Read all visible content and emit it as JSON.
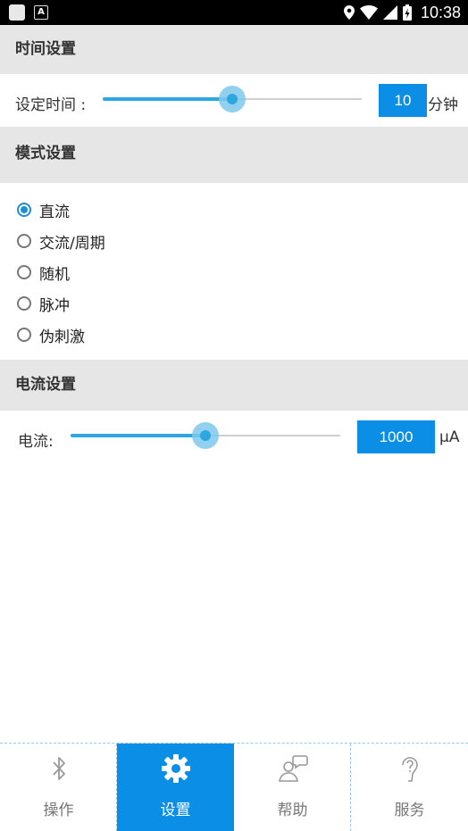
{
  "status_bar": {
    "time": "10:38"
  },
  "time_settings": {
    "header": "时间设置",
    "label": "设定时间 :",
    "value": "10",
    "unit": "分钟",
    "slider_fraction": 0.5
  },
  "mode_settings": {
    "header": "模式设置",
    "options": [
      {
        "label": "直流",
        "checked": true
      },
      {
        "label": "交流/周期",
        "checked": false
      },
      {
        "label": "随机",
        "checked": false
      },
      {
        "label": "脉冲",
        "checked": false
      },
      {
        "label": "伪刺激",
        "checked": false
      }
    ]
  },
  "current_settings": {
    "header": "电流设置",
    "label": "电流:",
    "value": "1000",
    "unit": "μA",
    "slider_fraction": 0.5
  },
  "bottom_nav": {
    "items": [
      {
        "label": "操作",
        "icon": "bluetooth-icon",
        "active": false
      },
      {
        "label": "设置",
        "icon": "gear-icon",
        "active": true
      },
      {
        "label": "帮助",
        "icon": "help-chat-icon",
        "active": false
      },
      {
        "label": "服务",
        "icon": "service-icon",
        "active": false
      }
    ]
  },
  "colors": {
    "accent": "#0b8ee6",
    "slider": "#2ea6e0",
    "header_bg": "#e6e6e6"
  }
}
